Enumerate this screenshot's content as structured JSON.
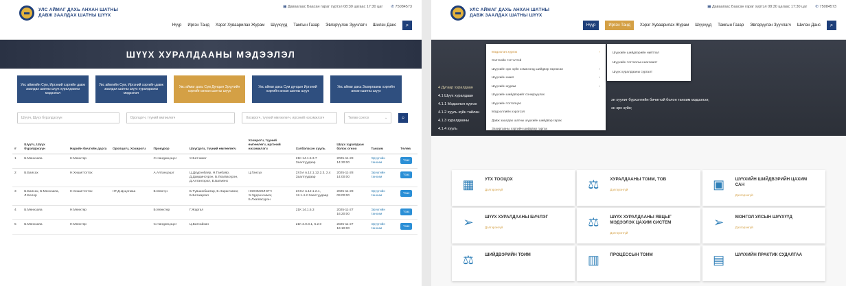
{
  "brand": {
    "line1": "УЛС АЙМАГ ДАХЬ АНХАН ШАТНЫ",
    "line2": "ДАВЖ ЗААЛДАХ ШАТНЫ ШҮҮХ",
    "hours": "Даваагаас Баасан гараг хүртэл 08:30 цагаас 17:30 цаг",
    "phone": "75084573"
  },
  "nav": {
    "items": [
      "Нүүр",
      "Иргэн Танд",
      "Хэрэг Хуваарилах Журам",
      "Шүүхүүд",
      "Тамгын Газар",
      "Эвлэрүүлэн Зуучлагч",
      "Шилэн Данс"
    ]
  },
  "left": {
    "banner_title": "ШҮҮХ ХУРАЛДААНЫ МЭДЭЭЛЭЛ",
    "categories": [
      {
        "label": "Увс аймгийн Сум, Иргэний хэргийн давж заалдах шатны шүүх хуралдааны мэдээлэл",
        "active": false
      },
      {
        "label": "Увс аймгийн Сум, Иргэний хэргийн давж заалдах шатны шүүх хуралдааны мэдээлэл",
        "active": false
      },
      {
        "label": "Увс аймаг дахь Сум Дундын Эрүүгийн хэргийн анхан шатны шүүх",
        "active": true
      },
      {
        "label": "Увс аймаг дахь Сум дундын Иргэний хэргийн анхан шатны шүүх",
        "active": false
      },
      {
        "label": "Увс аймаг дахь Захиргааны хэргийн анхан шатны шүүх",
        "active": false
      }
    ],
    "filters": {
      "judge_placeholder": "Шүүгч, Шүүх бүрэлдэхүүн",
      "litigant_placeholder": "Оролцогч, түүний өмгөөлөгч",
      "prosecutor_placeholder": "Хохирогч, түүний өмгөөлөгч, иргэний нэхэмжлэгч",
      "status_label": "Төлөв сонгох"
    },
    "table": {
      "headers": [
        "#",
        "Шүүгч, Шүүх бүрэлдэхүүн",
        "Нарийн бичгийн дарга",
        "Оролцогч, Хохирогч",
        "Прокурор",
        "Шүүгдэгч, түүний өмгөөлөгч",
        "Хохирогч, түүний өмгөөлөгч, иргэний нэхэмжлэгч",
        "Хэлбэлзсэн хууль",
        "Шүүх хуралдаан болох огноо",
        "Танхим",
        "Төлөв"
      ],
      "rows": [
        [
          "1",
          "Б.Мөнхзаяа",
          "Н.Мөнхтөр",
          "",
          "С.Нандинцэцэг",
          "Х.Батчимэг",
          "",
          "21К 14.1.5.3.7 Заалтуудаар",
          "2025-11-28 14:30:00",
          "Эрүүгийн танхим",
          "Үзэх"
        ],
        [
          "2",
          "Б.Баясах",
          "Н.Хишигтогтох",
          "",
          "А.Алтанцэцэг",
          "Ц.Дуурэнбаяр, Н.Ганбаяр, Д.Дамдинсүрэн, Б.Лхагвасүрэн, Д.Алтангэрэл, Б.Батмөнх",
          "Ц.Гансүх",
          "2ХХА в.12.1.12.2.3, 2.4 Заалтуудаар",
          "2025-11-28 14:00:00",
          "Эрүүгийн танхим",
          "Үзэх"
        ],
        [
          "3",
          "Б.Баясах, Б.Мөнхзаяа, Л.Болор",
          "Н.Хишигтогтох",
          "НТ.Д.Цэцэгмаа",
          "Б.Мөнгүн",
          "Б.Түвшинбаатар, Б.Наранчимэг, Б.Батжаргал",
          "НЭХЭМЖЛЭГЧ Э.Эрдэнэчимэг, Б.Лхагвасүрэн",
          "2ХХА в.12.1.2.1, 12.1.4.2 Заалтуудаар",
          "2025-11-28 09:00:00",
          "Эрүүгийн танхим",
          "Үзэх"
        ],
        [
          "4",
          "Б.Мөнхзаяа",
          "Н.Мөнхтөр",
          "",
          "Б.Мөнхтөр",
          "Г.Жаргал",
          "",
          "21К 14.1.5.3",
          "2025-11-27 16:20:00",
          "Эрүүгийн танхим",
          "Үзэх"
        ],
        [
          "5",
          "Б.Мөнхзаяа",
          "Н.Мөнхтөр",
          "",
          "С.Нандинцэцэг",
          "Ц.Батсайхан",
          "",
          "21К 3.0.8.1, 6.2.0",
          "2025-11-27 16:10:00",
          "Эрүүгийн танхим",
          "Үзэх"
        ]
      ]
    }
  },
  "right": {
    "dropdown": [
      "Мэдээлэл хүргэх",
      "Хэлтсийн тэгтэлтэй",
      "Шүүхийн эрх зүйн хэмжээнд шийдвэр гаргасан",
      "Шүүхийн ажил",
      "Шүүхийн журам",
      "Шүүхийн шийдвэрийг сонирхуулах",
      "Шүүхийн тогтолцоо",
      "Мэдээллийн хэрэгсэл",
      "Давж заалдах шатны шүүхийн шийдвэр гарах",
      "Захиргааны хэргийн шийдвэр гаргах"
    ],
    "submenu": [
      "Шүүхийн шийдвэрийн нийтлэл",
      "Шүүхийн тогтоолын жагсаалт",
      "Шүүх хуралдааны сургалт"
    ],
    "hero": {
      "heading": "4 Дугаар хуралдаан",
      "line1": "4.1 Шүүх хуралдаан",
      "line2": "4.1.1 Мэдээлэл хүргэх",
      "line3": "4.1.2 хууль зүйн тайлан",
      "line4": "4.1.3 хуралдааны",
      "line5": "4.1.4 хууль",
      "right1": "эн хуулиг бүрхэлтийн бичигтэй болон танхим мэдээлэл;",
      "right2": "эн эрх зүйн;"
    },
    "cards": [
      {
        "title": "УТХ ТООЦОХ",
        "more": "Дэлгэрэнгүй",
        "icon": "calculator-icon",
        "glyph": "▦"
      },
      {
        "title": "ХУРАЛДААНЫ ТОИМ, ТОВ",
        "more": "Дэлгэрэнгүй",
        "icon": "gavel-icon",
        "glyph": "⚖"
      },
      {
        "title": "ШҮҮХИЙН ШИЙДВЭРИЙН ЦАХИМ САН",
        "more": "Дэлгэрэнгүй",
        "icon": "archive-icon",
        "glyph": "▣"
      },
      {
        "title": "ШҮҮХ ХУРАЛДААНЫ БИЧЛЭГ",
        "more": "Дэлгэрэнгүй",
        "icon": "send-icon",
        "glyph": "➢"
      },
      {
        "title": "ШҮҮХ ХУРАЛДААНЫ ЯВЦЫГ МЭДЭЭЛЭХ ЦАХИМ СИСТЕМ",
        "more": "Дэлгэрэнгүй",
        "icon": "gavel-icon",
        "glyph": "⚖"
      },
      {
        "title": "МОНГОЛ УЛСЫН ШҮҮХҮҮД",
        "more": "Дэлгэрэнгүй",
        "icon": "send-icon",
        "glyph": "➢"
      },
      {
        "title": "ШИЙДВЭРИЙН ТОИМ",
        "more": "",
        "icon": "gavel-icon",
        "glyph": "⚖"
      },
      {
        "title": "ПРОЦЕССЫН ТОИМ",
        "more": "",
        "icon": "chart-icon",
        "glyph": "▥"
      },
      {
        "title": "ШҮҮХИЙН ПРАКТИК СУДАЛГАА",
        "more": "",
        "icon": "calendar-icon",
        "glyph": "▤"
      }
    ]
  },
  "colors": {
    "navy": "#1e3f7a",
    "gold": "#d4a045",
    "blue": "#2f4f7f",
    "view": "#2b8fd6"
  }
}
